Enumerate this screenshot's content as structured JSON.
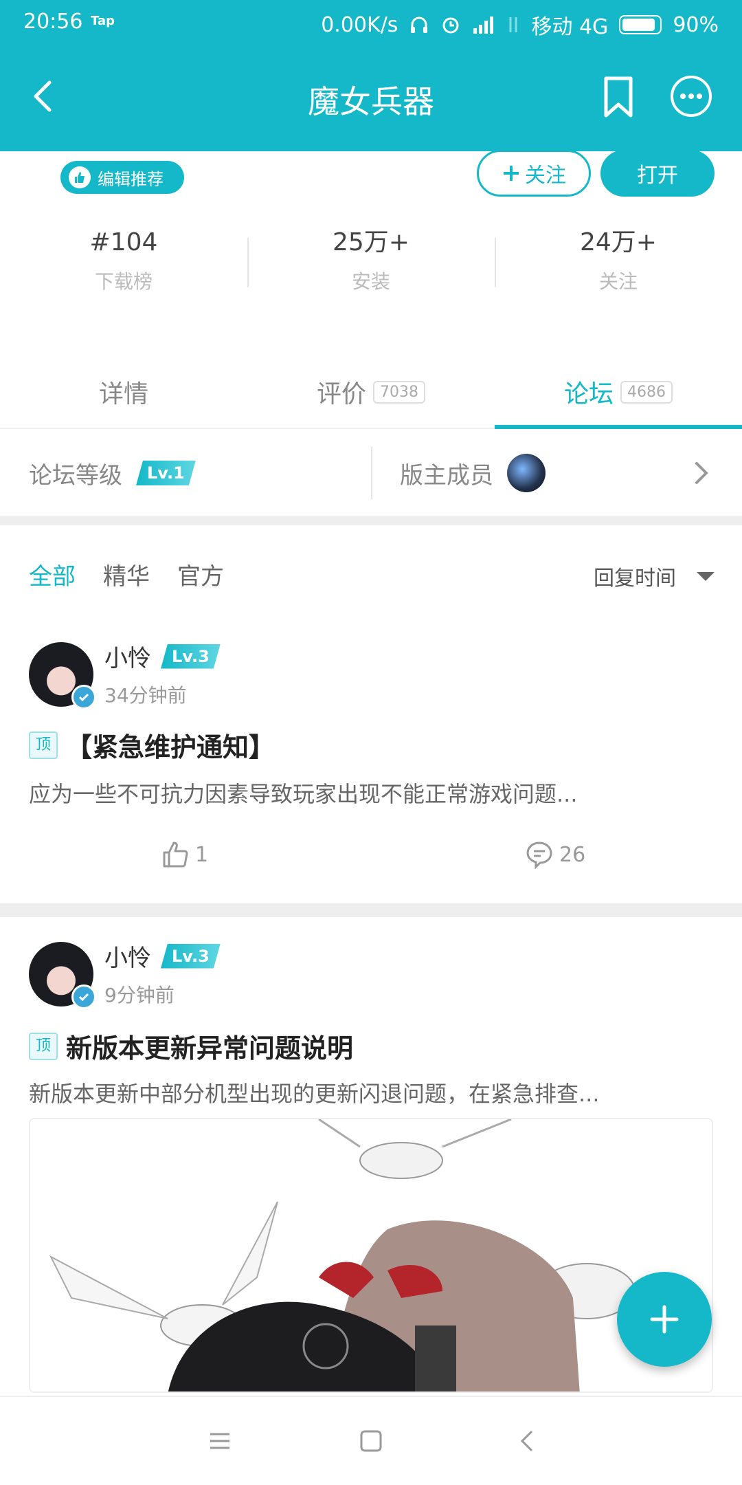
{
  "status_bar": {
    "time": "20:56",
    "tap_label": "Tap",
    "net_speed": "0.00K/s",
    "carrier": "移动 4G",
    "battery": "90%",
    "battery_level": 0.9
  },
  "app_bar": {
    "title": "魔女兵器"
  },
  "app_header": {
    "editor_badge": "编辑推荐",
    "follow_label": "关注",
    "open_label": "打开"
  },
  "stats": [
    {
      "value": "#104",
      "label": "下载榜"
    },
    {
      "value": "25万+",
      "label": "安装"
    },
    {
      "value": "24万+",
      "label": "关注"
    }
  ],
  "tabs": [
    {
      "label": "详情",
      "count": ""
    },
    {
      "label": "评价",
      "count": "7038"
    },
    {
      "label": "论坛",
      "count": "4686"
    }
  ],
  "forum_info": {
    "level_label": "论坛等级",
    "level_value": "Lv.1",
    "moderators_label": "版主成员"
  },
  "filters": {
    "items": [
      "全部",
      "精华",
      "官方"
    ],
    "sort_label": "回复时间"
  },
  "posts": [
    {
      "author": "小怜",
      "level": "Lv.3",
      "time": "34分钟前",
      "tag": "顶",
      "title": "【紧急维护通知】",
      "excerpt": "应为一些不可抗力因素导致玩家出现不能正常游戏问题...",
      "likes": "1",
      "comments": "26"
    },
    {
      "author": "小怜",
      "level": "Lv.3",
      "time": "9分钟前",
      "tag": "顶",
      "title": "新版本更新异常问题说明",
      "excerpt": "新版本更新中部分机型出现的更新闪退问题，在紧急排查..."
    }
  ],
  "colors": {
    "accent": "#14b8c8",
    "divider": "#eeeeee"
  }
}
